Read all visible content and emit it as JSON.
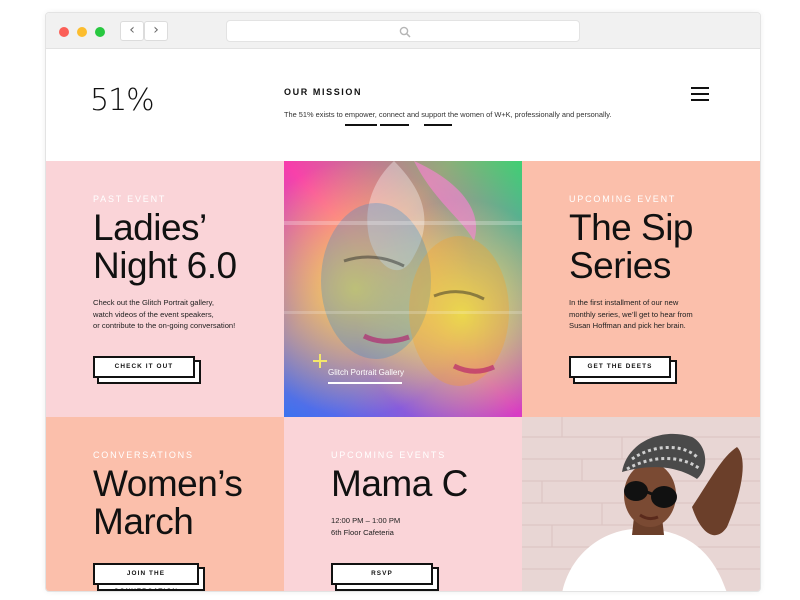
{
  "browser": {
    "back_label": "‹",
    "forward_label": "›",
    "search_icon": "search-icon"
  },
  "header": {
    "logo": "51%",
    "mission_title": "OUR MISSION",
    "mission_text": "The 51% exists to empower, connect and support the women of W+K, professionally and personally."
  },
  "tiles": {
    "ladies": {
      "eyebrow": "PAST EVENT",
      "headline_line1": "Ladies’",
      "headline_line2": "Night 6.0",
      "body_line1": "Check out the Glitch Portrait gallery,",
      "body_line2": "watch videos of the event speakers,",
      "body_line3": "or contribute to the on-going conversation!",
      "cta": "CHECK IT OUT"
    },
    "gallery": {
      "caption": "Glitch Portrait Gallery"
    },
    "sip": {
      "eyebrow": "UPCOMING EVENT",
      "headline_line1": "The Sip",
      "headline_line2": "Series",
      "body_line1": "In the first installment of our new",
      "body_line2": "monthly series, we’ll get to hear from",
      "body_line3": "Susan Hoffman and pick her brain.",
      "cta": "GET THE DEETS"
    },
    "womens_march": {
      "eyebrow": "CONVERSATIONS",
      "headline_line1": "Women’s",
      "headline_line2": "March",
      "cta": "JOIN THE CONVERSATION"
    },
    "mama_c": {
      "eyebrow": "UPCOMING EVENTS",
      "headline_line1": "Mama C",
      "body_line1": "12:00 PM – 1:00 PM",
      "body_line2": "6th Floor Cafeteria",
      "cta": "RSVP"
    }
  },
  "colors": {
    "pink": "#fad4d8",
    "peach": "#fbbfab",
    "gallery_accent": "#f4e76a"
  }
}
